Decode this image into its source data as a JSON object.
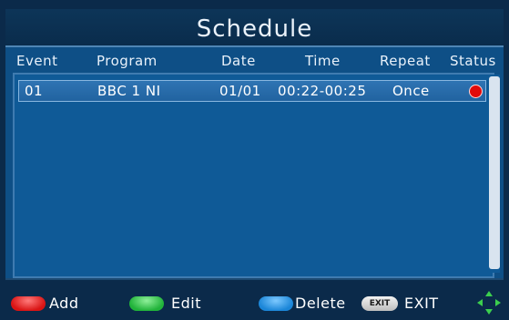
{
  "title": "Schedule",
  "columns": {
    "event": "Event",
    "program": "Program",
    "date": "Date",
    "time": "Time",
    "repeat": "Repeat",
    "status": "Status"
  },
  "rows": [
    {
      "event": "01",
      "program": "BBC 1 NI",
      "date": "01/01",
      "time": "00:22-00:25",
      "repeat": "Once",
      "status_icon": "red-dot-icon",
      "status_color": "#e10a0a"
    }
  ],
  "footer": {
    "add_label": "Add",
    "edit_label": "Edit",
    "delete_label": "Delete",
    "exit_key_label": "EXIT",
    "exit_label": "EXIT"
  },
  "colors": {
    "red_key": "#d91414",
    "green_key": "#21b33a",
    "blue_key": "#1b86d8"
  }
}
